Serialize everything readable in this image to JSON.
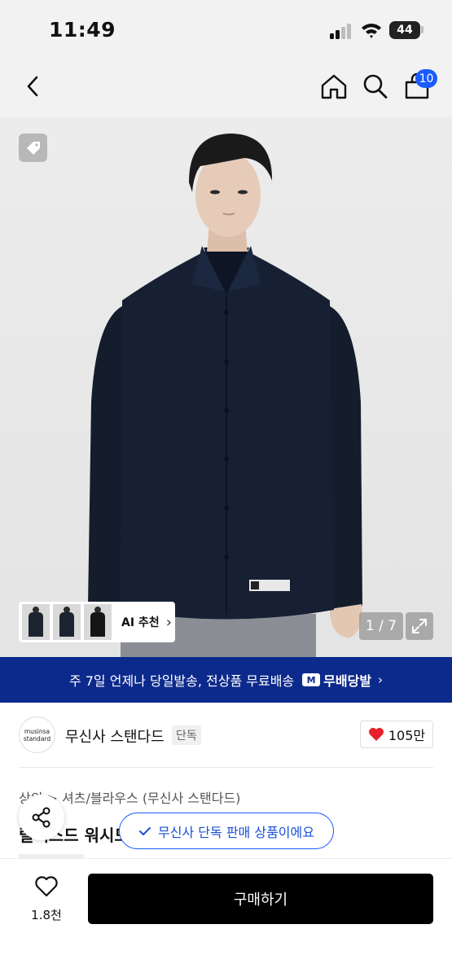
{
  "status_bar": {
    "time": "11:49",
    "battery": "44"
  },
  "nav": {
    "cart_count": "10",
    "icons": [
      "back-icon",
      "home-icon",
      "search-icon",
      "cart-icon"
    ]
  },
  "hero": {
    "ai_label": "AI 추천",
    "page_indicator": "1 / 7",
    "shirt_label": "musinsa standard"
  },
  "banner": {
    "text": "주 7일 언제나 당일발송, 전상품 무료배송",
    "logo_mark": "M",
    "logo_text": "무배당발"
  },
  "brand": {
    "logo_line1": "musinsa",
    "logo_line2": "standard",
    "name": "무신사 스탠다드",
    "badge": "단독",
    "likes": "105만"
  },
  "product": {
    "breadcrumb": "상의 > 셔츠/블라우스 (무신사 스탠다드)",
    "title": "릴렉스드 워시드 셔츠",
    "exclusive_notice": "무신사 단독 판매 상품이에요"
  },
  "bottom": {
    "wish_count": "1.8천",
    "buy_label": "구매하기"
  },
  "colors": {
    "accent_blue": "#1a5cff",
    "banner_blue": "#0c2a8c",
    "heart_red": "#e8202a",
    "buy_black": "#000000"
  }
}
